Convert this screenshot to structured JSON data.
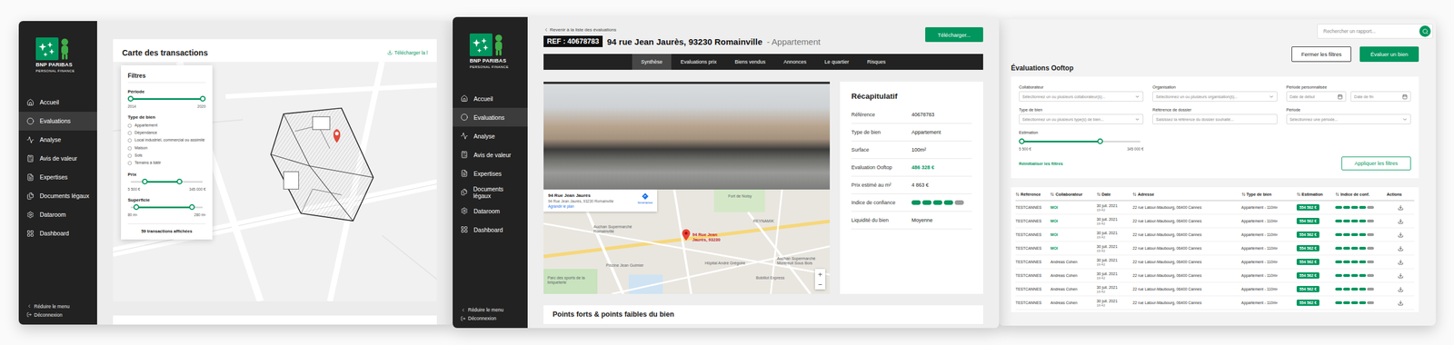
{
  "brand": {
    "name": "BNP PARIBAS",
    "subtitle": "PERSONAL FINANCE"
  },
  "sidebar": {
    "items": [
      {
        "label": "Accueil",
        "selected": false
      },
      {
        "label": "Evaluations",
        "selected": true
      },
      {
        "label": "Analyse",
        "selected": false
      },
      {
        "label": "Avis de valeur",
        "selected": false
      },
      {
        "label": "Expertises",
        "selected": false
      },
      {
        "label": "Documents légaux",
        "selected": false
      },
      {
        "label": "Dataroom",
        "selected": false
      },
      {
        "label": "Dashboard",
        "selected": false
      }
    ],
    "collapse": "Réduire le menu",
    "logout": "Déconnexion"
  },
  "transactions_map": {
    "title": "Carte des transactions",
    "download_link": "Télécharger la l",
    "filters": {
      "title": "Filtres",
      "sections": [
        {
          "kind": "range",
          "label": "Période",
          "level_low": 0.0,
          "level_high": 1.0,
          "min_label": "2014",
          "max_label": "2020"
        },
        {
          "kind": "checklist",
          "label": "Type de bien",
          "options": [
            {
              "label": "Appartement",
              "checked": false
            },
            {
              "label": "Dépendance",
              "checked": false
            },
            {
              "label": "Local industriel, commercial ou assimilé",
              "checked": false
            },
            {
              "label": "Maison",
              "checked": false
            },
            {
              "label": "Sols",
              "checked": false
            },
            {
              "label": "Terrains à bâtir",
              "checked": false
            }
          ]
        },
        {
          "kind": "range",
          "label": "Prix",
          "level_low": 0.2,
          "level_high": 0.68,
          "min_label": "5 500 €",
          "max_label": "345 000 €"
        },
        {
          "kind": "range",
          "label": "Superficie",
          "level_low": 0.08,
          "level_high": 0.85,
          "min_label": "80 m²",
          "max_label": "280 m²"
        }
      ],
      "count": "59 transactions affichées"
    }
  },
  "report": {
    "back": "Revenir à la liste des évaluations",
    "ref": "REF : 40678783",
    "address": "94 rue Jean Jaurès, 93230 Romainville",
    "type": "- Appartement",
    "download": "Télécharger...",
    "tabs": [
      {
        "label": "Synthèse",
        "selected": true
      },
      {
        "label": "Evaluations prix",
        "selected": false
      },
      {
        "label": "Biens vendus",
        "selected": false
      },
      {
        "label": "Annonces",
        "selected": false
      },
      {
        "label": "Le quartier",
        "selected": false
      },
      {
        "label": "Risques",
        "selected": false
      }
    ],
    "map": {
      "card_title": "94 Rue Jean Jaurès",
      "card_address": "94 Rue Jean Jaurès, 93230 Romainville",
      "enlarge": "Agrandir le plan",
      "directions": "Itinéraires",
      "pin_label": "94 Rue Jean Jaurès, 93230",
      "places": [
        "Fort de Noisy",
        "Auchan Supermarché Romainville",
        "Piscine Jean Guimier",
        "Hôpital André Grégoire",
        "REYNAMIK",
        "Auchan Supermarché Montreuil Sous Bois",
        "Bobillot Express",
        "Parc des sports de la briqueterie"
      ],
      "zoom_in": "+",
      "zoom_out": "−"
    },
    "summary": {
      "title": "Récapitulatif",
      "rows": [
        {
          "kind": "text",
          "label": "Référence",
          "value": "40678783"
        },
        {
          "kind": "text",
          "label": "Type de bien",
          "value": "Appartement"
        },
        {
          "kind": "text",
          "label": "Surface",
          "value": "100m²"
        },
        {
          "kind": "highlight",
          "label": "Evaluation Ooftop",
          "value": "486 328 €"
        },
        {
          "kind": "text",
          "label": "Prix estimé au m²",
          "value": "4 863 €"
        },
        {
          "kind": "meter",
          "label": "Indice de confiance",
          "level": 0.8
        },
        {
          "kind": "text",
          "label": "Liquidité du bien",
          "value": "Moyenne"
        }
      ]
    },
    "section_title": "Points forts & points faibles du bien"
  },
  "list": {
    "search": {
      "placeholder": "Rechercher un rapport..."
    },
    "close_filters": "Fermer les filtres",
    "evaluate": "Évaluer un bien",
    "title": "Évaluations Ooftop",
    "filters": {
      "fields": [
        {
          "kind": "select",
          "label": "Collaborateur",
          "placeholder": "Sélectionnez un ou plusieurs collaborateur(s)..."
        },
        {
          "kind": "select",
          "label": "Organisation",
          "placeholder": "Sélectionnez un ou plusieurs organisation(s)..."
        },
        {
          "kind": "dates",
          "label": "Période personnalisée",
          "placeholders": [
            "Date de début",
            "Date de fin"
          ]
        },
        {
          "kind": "select",
          "label": "Type de bien",
          "placeholder": "Sélectionnez un ou plusieurs type(s) de bien..."
        },
        {
          "kind": "input",
          "label": "Référence de dossier",
          "placeholder": "Saisissez la référence du dossier souhaité..."
        },
        {
          "kind": "select",
          "label": "Période",
          "placeholder": "Sélectionnez une période..."
        },
        {
          "kind": "range",
          "label": "Estimation",
          "level_low": 0.0,
          "level_high": 0.66,
          "min_label": "5 500 €",
          "max_label": "345 000 €"
        }
      ],
      "reset": "Réinitialiser les filtres",
      "apply": "Appliquer les filtres"
    },
    "table": {
      "columns": [
        "Référence",
        "Collaborateur",
        "Date",
        "Adresse",
        "Type de bien",
        "Estimation",
        "Indice de conf.",
        "Actions"
      ],
      "rows": [
        {
          "reference": "TESTCANNES",
          "collaborator": "MOI",
          "highlighted": true,
          "date": "30 juil. 2021",
          "time": "19:42",
          "address": "22 rue Latour-Maubourg, 06400 Cannes",
          "type": "Appartement - 110m²",
          "estimation": "554 562 €",
          "confidence": 0.8
        },
        {
          "reference": "TESTCANNES",
          "collaborator": "MOI",
          "highlighted": true,
          "date": "30 juil. 2021",
          "time": "19:42",
          "address": "22 rue Latour-Maubourg, 06400 Cannes",
          "type": "Appartement - 110m²",
          "estimation": "554 562 €",
          "confidence": 0.8
        },
        {
          "reference": "TESTCANNES",
          "collaborator": "MOI",
          "highlighted": true,
          "date": "30 juil. 2021",
          "time": "19:42",
          "address": "22 rue Latour-Maubourg, 06400 Cannes",
          "type": "Appartement - 110m²",
          "estimation": "554 562 €",
          "confidence": 0.8
        },
        {
          "reference": "TESTCANNES",
          "collaborator": "MOI",
          "highlighted": true,
          "date": "30 juil. 2021",
          "time": "19:42",
          "address": "22 rue Latour-Maubourg, 06400 Cannes",
          "type": "Appartement - 110m²",
          "estimation": "554 562 €",
          "confidence": 0.8
        },
        {
          "reference": "TESTCANNES",
          "collaborator": "Andreas Cohen",
          "highlighted": false,
          "date": "30 juil. 2021",
          "time": "19:42",
          "address": "22 rue Latour-Maubourg, 06400 Cannes",
          "type": "Appartement - 110m²",
          "estimation": "554 562 €",
          "confidence": 0.8
        },
        {
          "reference": "TESTCANNES",
          "collaborator": "Andreas Cohen",
          "highlighted": false,
          "date": "30 juil. 2021",
          "time": "19:42",
          "address": "22 rue Latour-Maubourg, 06400 Cannes",
          "type": "Appartement - 110m²",
          "estimation": "554 562 €",
          "confidence": 0.8
        },
        {
          "reference": "TESTCANNES",
          "collaborator": "Andreas Cohen",
          "highlighted": false,
          "date": "30 juil. 2021",
          "time": "19:42",
          "address": "22 rue Latour-Maubourg, 06400 Cannes",
          "type": "Appartement - 110m²",
          "estimation": "554 562 €",
          "confidence": 0.8
        },
        {
          "reference": "TESTCANNES",
          "collaborator": "Andreas Cohen",
          "highlighted": false,
          "date": "30 juil. 2021",
          "time": "19:42",
          "address": "22 rue Latour-Maubourg, 06400 Cannes",
          "type": "Appartement - 110m²",
          "estimation": "554 562 €",
          "confidence": 0.8
        }
      ]
    }
  }
}
